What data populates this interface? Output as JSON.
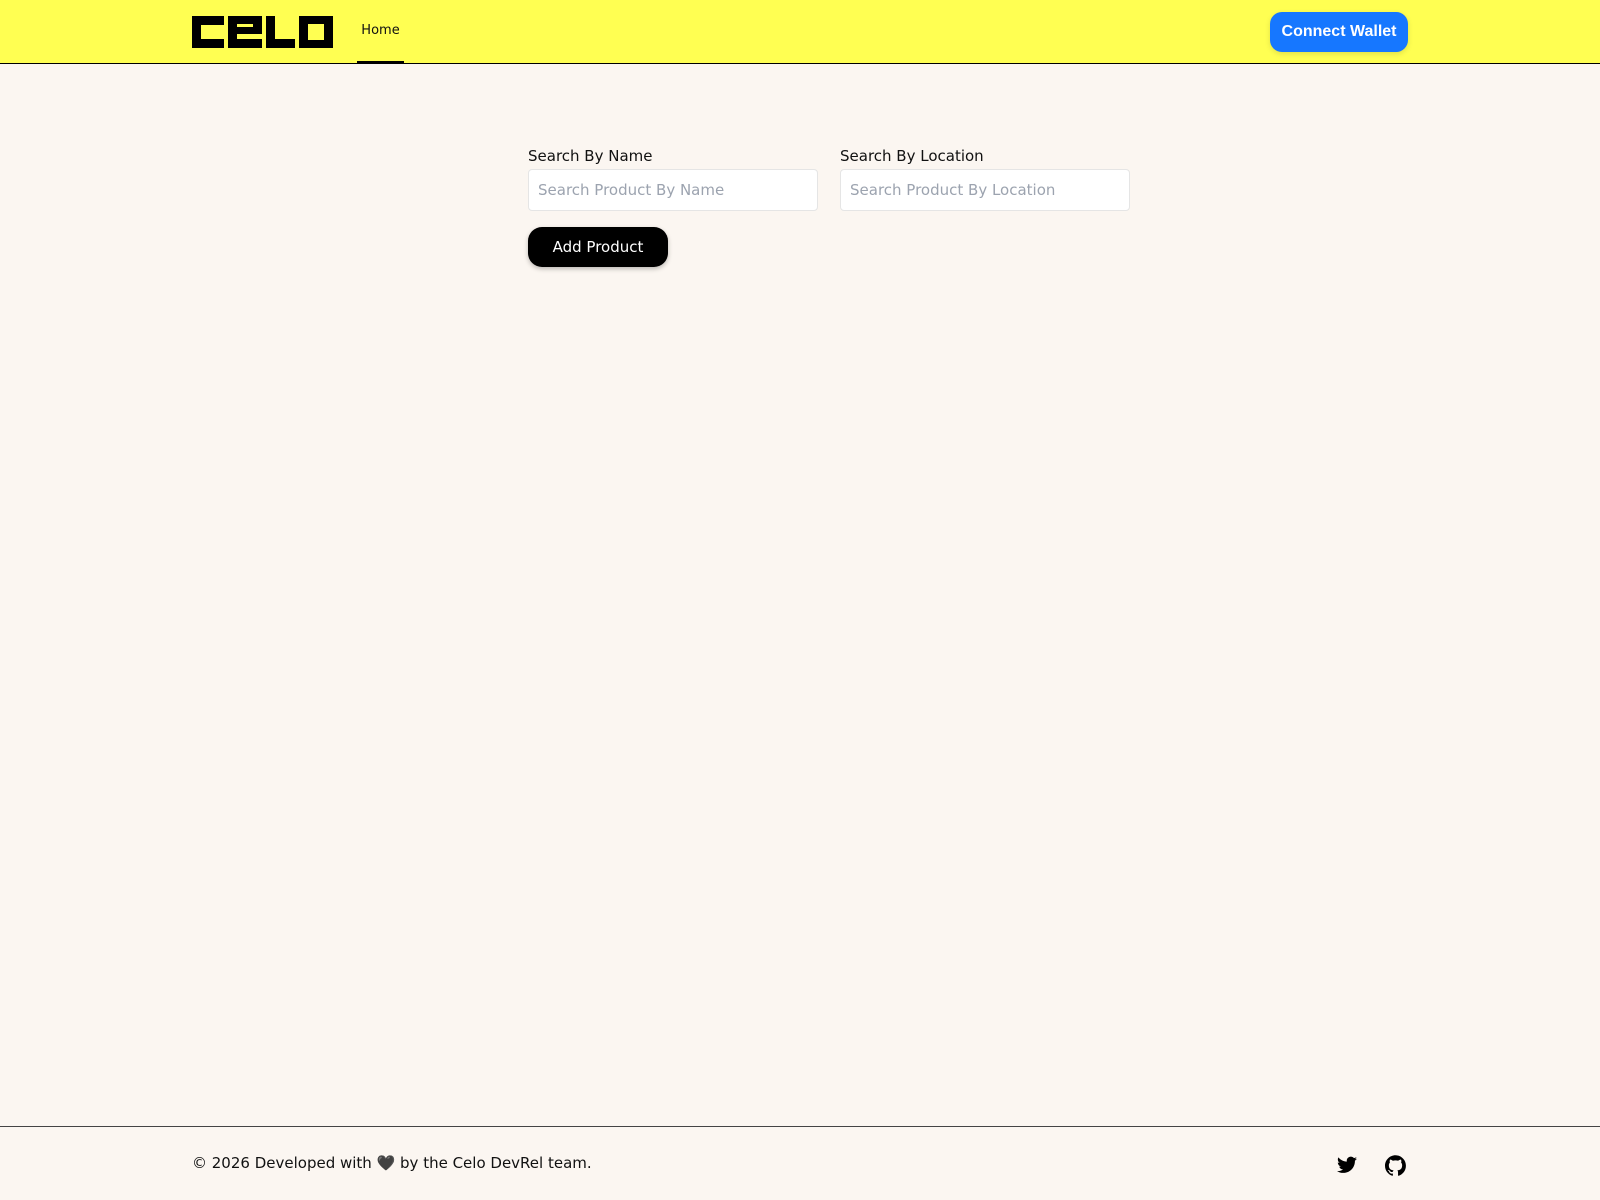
{
  "header": {
    "logo_text": "Celo",
    "nav": [
      {
        "label": "Home",
        "active": true
      }
    ],
    "connect_wallet_label": "Connect Wallet"
  },
  "search": {
    "name_label": "Search By Name",
    "name_placeholder": "Search Product By Name",
    "name_value": "",
    "location_label": "Search By Location",
    "location_placeholder": "Search Product By Location",
    "location_value": ""
  },
  "actions": {
    "add_product_label": "Add Product"
  },
  "footer": {
    "text_before": "© 2026 Developed with ",
    "heart": "🖤",
    "text_after": " by the Celo DevRel team.",
    "social_icons": [
      "twitter-icon",
      "github-icon"
    ]
  },
  "colors": {
    "header_bg": "#FFFF52",
    "page_bg": "#FBF6F1",
    "connect_button": "#1677FF",
    "primary_button": "#000000"
  }
}
